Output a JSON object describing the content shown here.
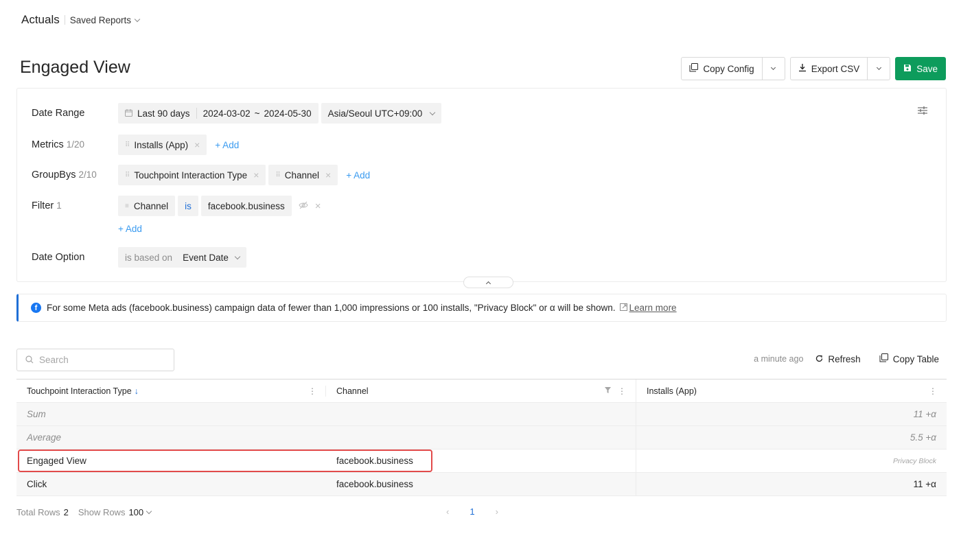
{
  "topbar": {
    "app_title": "Actuals",
    "saved_reports": "Saved Reports"
  },
  "page": {
    "title": "Engaged View"
  },
  "actions": {
    "copy_config": "Copy Config",
    "export_csv": "Export CSV",
    "save": "Save"
  },
  "config": {
    "date_range": {
      "label": "Date Range",
      "preset": "Last 90 days",
      "start": "2024-03-02",
      "tilde": "~",
      "end": "2024-05-30",
      "timezone": "Asia/Seoul UTC+09:00"
    },
    "metrics": {
      "label": "Metrics",
      "count": "1/20",
      "items": [
        "Installs (App)"
      ],
      "add": "+ Add"
    },
    "groupbys": {
      "label": "GroupBys",
      "count": "2/10",
      "items": [
        "Touchpoint Interaction Type",
        "Channel"
      ],
      "add": "+ Add"
    },
    "filter": {
      "label": "Filter",
      "count": "1",
      "field": "Channel",
      "operator": "is",
      "value": "facebook.business",
      "add": "+ Add"
    },
    "date_option": {
      "label": "Date Option",
      "prefix": "is based on",
      "value": "Event Date"
    }
  },
  "notice": {
    "text": "For some Meta ads (facebook.business) campaign data of fewer than 1,000 impressions or 100 installs, \"Privacy Block\" or α will be shown.",
    "link": "Learn more"
  },
  "table_toolbar": {
    "search_placeholder": "Search",
    "updated": "a minute ago",
    "refresh": "Refresh",
    "copy_table": "Copy Table"
  },
  "table": {
    "columns": [
      "Touchpoint Interaction Type",
      "Channel",
      "Installs (App)"
    ],
    "sum": {
      "label": "Sum",
      "value": "11 +α"
    },
    "average": {
      "label": "Average",
      "value": "5.5 +α"
    },
    "rows": [
      {
        "type": "Engaged View",
        "channel": "facebook.business",
        "installs": "Privacy Block"
      },
      {
        "type": "Click",
        "channel": "facebook.business",
        "installs": "11 +α"
      }
    ]
  },
  "footer": {
    "total_rows_label": "Total Rows",
    "total_rows": "2",
    "show_rows_label": "Show Rows",
    "show_rows": "100",
    "page": "1"
  },
  "colors": {
    "accent": "#1f6fd6",
    "save": "#0d9c5c",
    "highlight": "#e24a4a",
    "facebook": "#1877f2"
  }
}
